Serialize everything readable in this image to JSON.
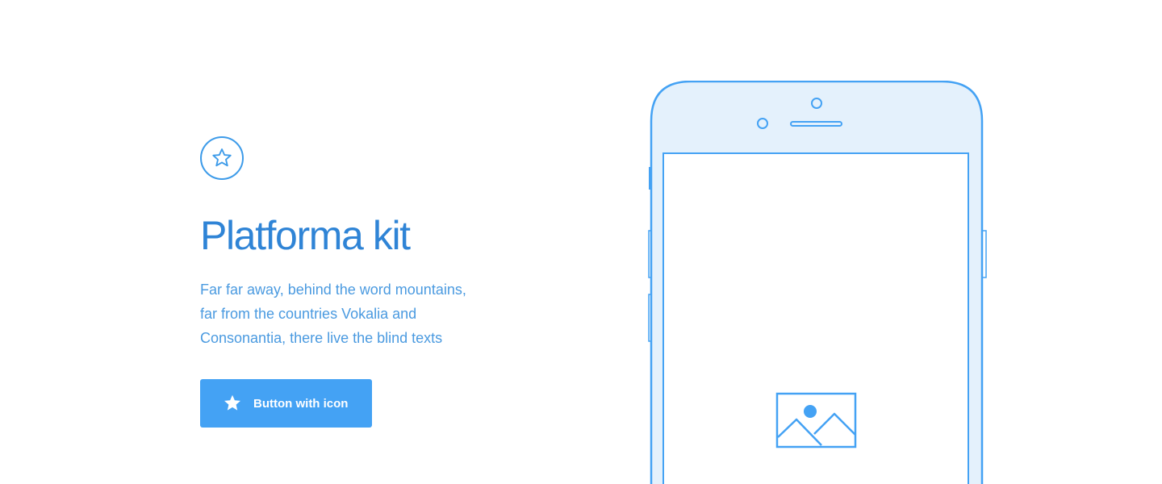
{
  "hero": {
    "badge_icon": "star-outline-icon",
    "title": "Platforma kit",
    "description_lines": [
      "Far far away, behind the word mountains,",
      "far from the countries Vokalia and",
      "Consonantia, there live the blind texts"
    ],
    "button": {
      "label": "Button with icon",
      "icon": "star-icon"
    }
  },
  "phone": {
    "screen_placeholder_icon": "image-icon"
  },
  "colors": {
    "accent": "#44a2f4",
    "title": "#2f84d6",
    "text": "#4a9ae0",
    "outline": "#3d9be9",
    "phone_fill": "#e4f1fc"
  }
}
